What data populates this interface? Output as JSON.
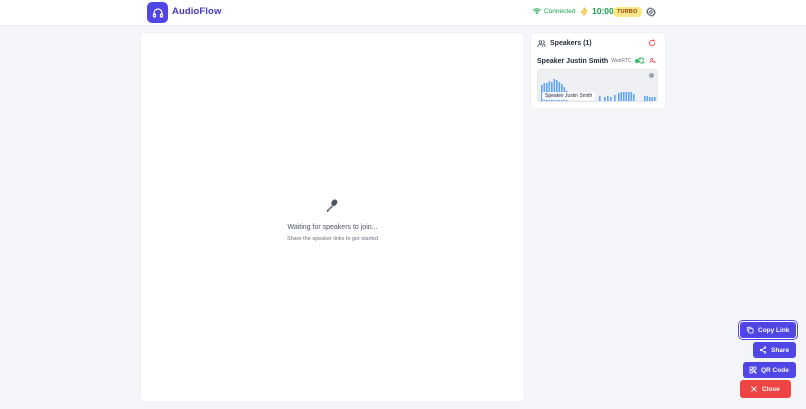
{
  "app": {
    "title": "AudioFlow"
  },
  "header": {
    "status": "Connected",
    "timer": "10:00",
    "badge": "TURBO"
  },
  "main": {
    "mic_glyph": "🎤",
    "empty_title": "Waiting for speakers to join...",
    "empty_subtitle": "Share the speaker links to get started"
  },
  "speakers": {
    "title": "Speakers (1)",
    "items": [
      {
        "name": "Speaker Justin Smith",
        "tag": "WebRTC",
        "preview_label": "Speaker Justin Smith"
      }
    ]
  },
  "actions": {
    "copy_link": "Copy Link",
    "share": "Share",
    "qr_code": "QR Code",
    "close": "Close"
  },
  "colors": {
    "accent": "#4f46e5",
    "success": "#16a34a",
    "danger": "#ef4444",
    "badge_bg": "#fde68a"
  },
  "icons": [
    "headphones-icon",
    "wifi-icon",
    "bolt-icon",
    "gear-icon",
    "microphone-icon",
    "users-icon",
    "refresh-icon",
    "sync-icon",
    "mute-user-icon",
    "copy-icon",
    "share-icon",
    "qr-icon",
    "close-icon"
  ]
}
